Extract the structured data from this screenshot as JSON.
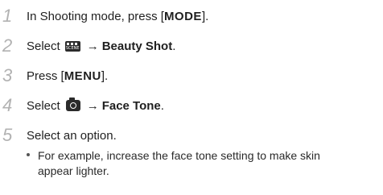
{
  "steps": [
    {
      "num": "1",
      "pre": "In Shooting mode, press [",
      "key": "MODE",
      "post": "]."
    },
    {
      "num": "2",
      "pre": "Select",
      "icon": "scene-icon",
      "icon_text": "SCENE",
      "arrow": "→",
      "target": "Beauty Shot",
      "post": "."
    },
    {
      "num": "3",
      "pre": "Press [",
      "key": "MENU",
      "post": "]."
    },
    {
      "num": "4",
      "pre": "Select",
      "icon": "camera-icon",
      "arrow": "→",
      "target": "Face Tone",
      "post": "."
    },
    {
      "num": "5",
      "text": "Select an option."
    }
  ],
  "note": {
    "line1": "For example, increase the face tone setting to make skin",
    "line2": "appear lighter."
  }
}
